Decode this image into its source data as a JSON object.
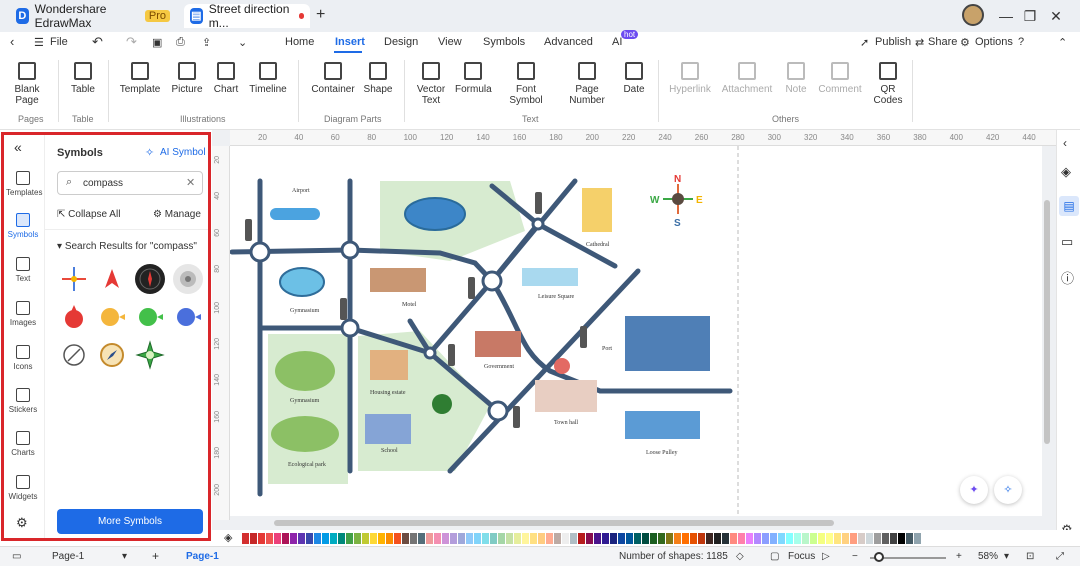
{
  "titlebar": {
    "app_name": "Wondershare EdrawMax",
    "pro_badge": "Pro",
    "doc_tab": "Street direction m...",
    "new_tab": "+"
  },
  "menu": {
    "file": "File",
    "tabs": [
      "Home",
      "Insert",
      "Design",
      "View",
      "Symbols",
      "Advanced",
      "AI"
    ],
    "active_tab": "Insert",
    "ai_badge": "hot",
    "publish": "Publish",
    "share": "Share",
    "options": "Options"
  },
  "ribbon": {
    "pages": {
      "blank_page_1": "Blank",
      "blank_page_2": "Page",
      "group": "Pages"
    },
    "table": {
      "table": "Table",
      "group": "Table"
    },
    "illustrations": {
      "template": "Template",
      "picture": "Picture",
      "chart": "Chart",
      "timeline": "Timeline",
      "group": "Illustrations"
    },
    "diagram_parts": {
      "container": "Container",
      "shape": "Shape",
      "group": "Diagram Parts"
    },
    "text": {
      "vector_1": "Vector",
      "vector_2": "Text",
      "formula": "Formula",
      "font_1": "Font",
      "font_2": "Symbol",
      "pagenum_1": "Page",
      "pagenum_2": "Number",
      "date": "Date",
      "group": "Text"
    },
    "others": {
      "hyperlink": "Hyperlink",
      "attachment": "Attachment",
      "note": "Note",
      "comment": "Comment",
      "qr_1": "QR",
      "qr_2": "Codes",
      "group": "Others"
    }
  },
  "leftrail": {
    "items": [
      "Templates",
      "Symbols",
      "Text",
      "Images",
      "Icons",
      "Stickers",
      "Charts",
      "Widgets"
    ],
    "selected": "Symbols"
  },
  "panel": {
    "title": "Symbols",
    "ai_symbol": "AI Symbol",
    "search_value": "compass",
    "collapse_all": "Collapse All",
    "manage": "Manage",
    "results_label": "Search Results for",
    "results_query": "\"compass\"",
    "more_symbols": "More Symbols"
  },
  "ruler": {
    "top_ticks": [
      "20",
      "40",
      "60",
      "80",
      "100",
      "120",
      "140",
      "160",
      "180",
      "200",
      "220",
      "240",
      "260",
      "280",
      "300",
      "320",
      "340",
      "360",
      "380",
      "400",
      "420",
      "440"
    ],
    "left_ticks": [
      "20",
      "40",
      "60",
      "80",
      "100",
      "120",
      "140",
      "160",
      "180",
      "200"
    ]
  },
  "map": {
    "labels": {
      "airport": "Airport",
      "gymnasium_1": "Gymnasium",
      "motel": "Motel",
      "leisure_square": "Leisure Square",
      "cathedral": "Cathedral",
      "port": "Port",
      "government": "Government",
      "gymnasium_2": "Gymnasium",
      "housing_estate": "Housing estate",
      "school": "School",
      "ecological_park": "Ecological park",
      "town_hall": "Town hall",
      "loose_pulley": "Loose Pulley"
    },
    "compass": {
      "n": "N",
      "s": "S",
      "e": "E",
      "w": "W"
    }
  },
  "status": {
    "page_tab": "Page-1",
    "active_page": "Page-1",
    "shapes_label": "Number of shapes:",
    "shapes_count": "1185",
    "focus": "Focus",
    "zoom": "58%"
  },
  "colors": {
    "accent": "#1e6be6",
    "highlight_box": "#d9262a",
    "road": "#3e5878",
    "park": "#d7ebd0"
  },
  "palette": [
    "#d32f2f",
    "#c62828",
    "#e53935",
    "#ef5350",
    "#ec407a",
    "#ad1457",
    "#8e24aa",
    "#5e35b1",
    "#3949ab",
    "#1e88e5",
    "#039be5",
    "#00acc1",
    "#00897b",
    "#43a047",
    "#7cb342",
    "#c0ca33",
    "#fdd835",
    "#ffb300",
    "#fb8c00",
    "#f4511e",
    "#6d4c41",
    "#757575",
    "#546e7a",
    "#ef9a9a",
    "#f48fb1",
    "#ce93d8",
    "#b39ddb",
    "#9fa8da",
    "#90caf9",
    "#81d4fa",
    "#80deea",
    "#80cbc4",
    "#a5d6a7",
    "#c5e1a5",
    "#e6ee9c",
    "#fff59d",
    "#ffe082",
    "#ffcc80",
    "#ffab91",
    "#bcaaa4",
    "#eeeeee",
    "#b0bec5",
    "#b71c1c",
    "#880e4f",
    "#4a148c",
    "#311b92",
    "#1a237e",
    "#0d47a1",
    "#01579b",
    "#006064",
    "#004d40",
    "#1b5e20",
    "#33691e",
    "#827717",
    "#f57f17",
    "#ff6f00",
    "#e65100",
    "#bf360c",
    "#3e2723",
    "#212121",
    "#263238",
    "#ff8a80",
    "#ff80ab",
    "#ea80fc",
    "#b388ff",
    "#8c9eff",
    "#82b1ff",
    "#80d8ff",
    "#84ffff",
    "#a7ffeb",
    "#b9f6ca",
    "#ccff90",
    "#f4ff81",
    "#ffff8d",
    "#ffe57f",
    "#ffd180",
    "#ff9e80",
    "#d7ccc8",
    "#cfd8dc",
    "#9e9e9e",
    "#616161",
    "#424242",
    "#000000",
    "#455a64",
    "#90a4ae",
    "#ffffff"
  ]
}
